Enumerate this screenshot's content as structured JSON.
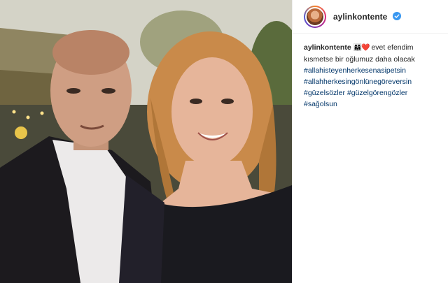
{
  "post": {
    "username": "aylinkontente",
    "verified": true,
    "avatar": "profile-avatar",
    "caption": {
      "user": "aylinkontente",
      "emoji": "👩‍👩‍👧❤️",
      "text": "evet efendim kısmetse bir oğlumuz daha olacak",
      "hashtags": [
        "#allahisteyenherkesenasipetsin",
        "#allahherkesingönlünegöreversin",
        "#güzelsözler",
        "#güzelgörengözler",
        "#sağolsun"
      ]
    }
  },
  "colors": {
    "hashtag": "#003569",
    "verified": "#3897f0",
    "text": "#262626"
  }
}
